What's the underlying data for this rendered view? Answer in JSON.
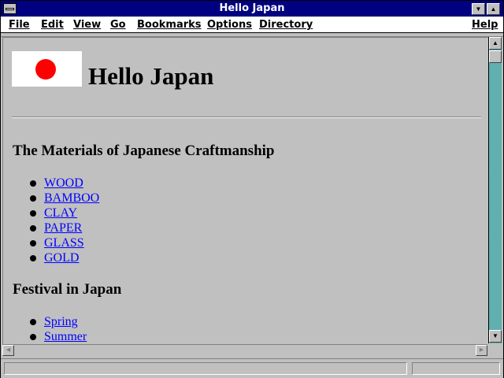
{
  "window": {
    "title": "Hello Japan"
  },
  "menubar": {
    "items": [
      "File",
      "Edit",
      "View",
      "Go",
      "Bookmarks",
      "Options",
      "Directory"
    ],
    "help": "Help"
  },
  "page": {
    "heading": "Hello Japan",
    "sections": [
      {
        "title": "The Materials of Japanese Craftmanship",
        "links": [
          "WOOD",
          "BAMBOO",
          "CLAY",
          "PAPER",
          "GLASS",
          "GOLD"
        ]
      },
      {
        "title": "Festival in Japan",
        "links": [
          "Spring",
          "Summer"
        ]
      }
    ]
  },
  "icons": {
    "system_menu": "system-menu-icon",
    "minimize": "minimize-icon",
    "maximize": "maximize-icon",
    "scroll_up": "arrow-up-icon",
    "scroll_down": "arrow-down-icon",
    "scroll_left": "arrow-left-icon",
    "scroll_right": "arrow-right-icon"
  },
  "colors": {
    "titlebar": "#000080",
    "link": "#0000ff",
    "flag_sun": "#ff0000",
    "scrollbar_track": "#40a0a0"
  }
}
